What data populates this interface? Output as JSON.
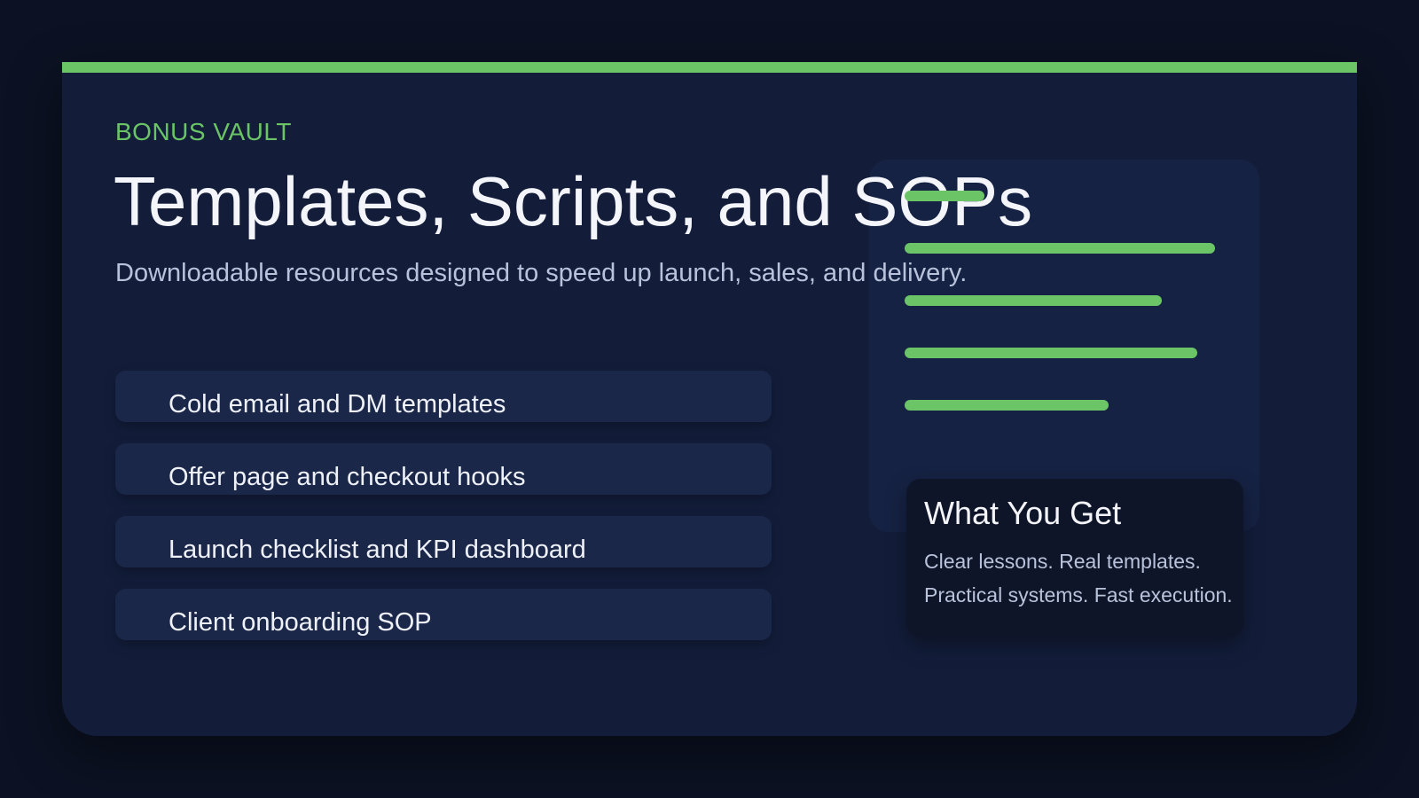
{
  "header": {
    "eyebrow": "BONUS VAULT",
    "title": "Templates, Scripts, and SOPs",
    "subtitle": "Downloadable resources designed to speed up launch, sales, and delivery."
  },
  "resources": [
    {
      "label": "Cold email and DM templates"
    },
    {
      "label": "Offer page and checkout hooks"
    },
    {
      "label": "Launch checklist and KPI dashboard"
    },
    {
      "label": "Client onboarding SOP"
    }
  ],
  "info_card": {
    "title": "What You Get",
    "line1": "Clear lessons. Real templates.",
    "line2": "Practical systems. Fast execution."
  },
  "colors": {
    "accent": "#6bc566",
    "background": "#0c1223",
    "card": "#131d3a",
    "list_item": "#1b2749",
    "info_card": "#0f1529"
  }
}
